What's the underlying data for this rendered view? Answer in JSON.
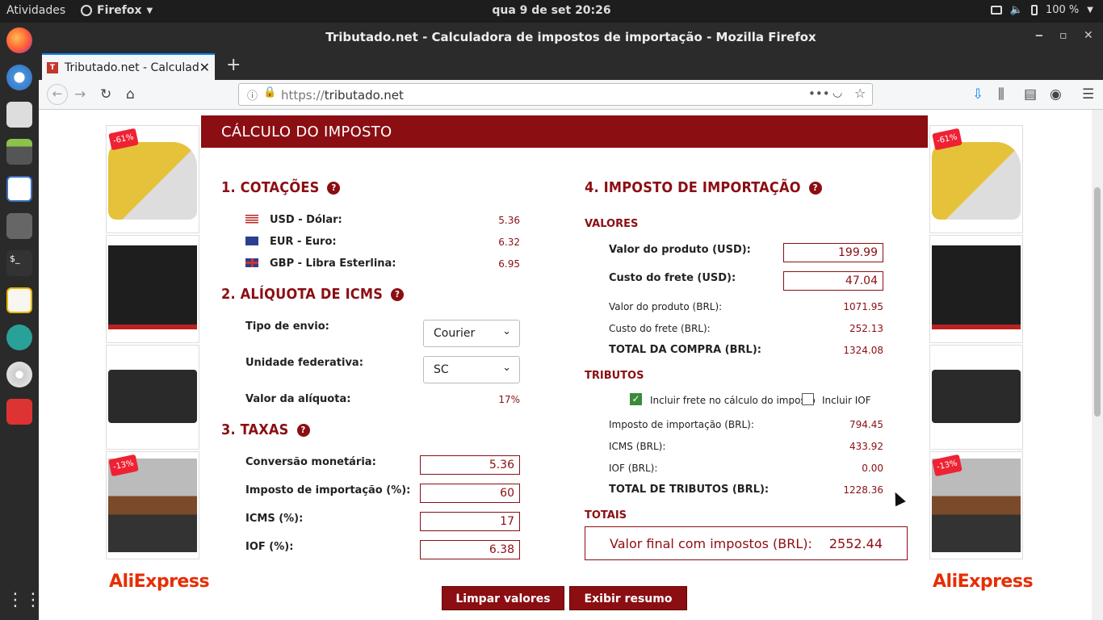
{
  "gnome": {
    "activities": "Atividades",
    "app_name": "Firefox",
    "clock": "qua 9 de set  20:26",
    "battery": "100 %"
  },
  "window": {
    "title": "Tributado.net - Calculadora de impostos de importação - Mozilla Firefox"
  },
  "tab": {
    "title": "Tributado.net - Calculad",
    "favicon": "T"
  },
  "url": {
    "scheme": "https://",
    "host": "tributado.net"
  },
  "ads": {
    "brand": "AliExpress",
    "badge_1": "-61%",
    "badge_2": "-13%"
  },
  "calc": {
    "header": "CÁLCULO DO IMPOSTO",
    "s1_title": "1. COTAÇÕES",
    "usd_label": "USD - Dólar:",
    "usd_value": "5.36",
    "eur_label": "EUR - Euro:",
    "eur_value": "6.32",
    "gbp_label": "GBP - Libra Esterlina:",
    "gbp_value": "6.95",
    "s2_title": "2. ALÍQUOTA DE ICMS",
    "tipo_label": "Tipo de envio:",
    "tipo_value": "Courier",
    "uf_label": "Unidade federativa:",
    "uf_value": "SC",
    "aliquota_label": "Valor da alíquota:",
    "aliquota_value": "17%",
    "s3_title": "3. TAXAS",
    "conv_label": "Conversão monetária:",
    "conv_value": "5.36",
    "ii_label": "Imposto de importação (%):",
    "ii_value": "60",
    "icms_label": "ICMS (%):",
    "icms_value": "17",
    "iof_label": "IOF (%):",
    "iof_value": "6.38",
    "s4_title": "4. IMPOSTO DE IMPORTAÇÃO",
    "valores": "VALORES",
    "prod_usd_label": "Valor do produto (USD):",
    "prod_usd_value": "199.99",
    "frete_usd_label": "Custo do frete (USD):",
    "frete_usd_value": "47.04",
    "prod_brl_label": "Valor do produto (BRL):",
    "prod_brl_value": "1071.95",
    "frete_brl_label": "Custo do frete (BRL):",
    "frete_brl_value": "252.13",
    "total_compra_label": "TOTAL DA COMPRA (BRL):",
    "total_compra_value": "1324.08",
    "tributos": "TRIBUTOS",
    "incl_frete_label": "Incluir frete no cálculo do imposto",
    "incl_iof_label": "Incluir IOF",
    "ii_brl_label": "Imposto de importação (BRL):",
    "ii_brl_value": "794.45",
    "icms_brl_label": "ICMS (BRL):",
    "icms_brl_value": "433.92",
    "iof_brl_label": "IOF (BRL):",
    "iof_brl_value": "0.00",
    "total_trib_label": "TOTAL DE TRIBUTOS (BRL):",
    "total_trib_value": "1228.36",
    "totais": "TOTAIS",
    "final_label": "Valor final com impostos (BRL):",
    "final_value": "2552.44",
    "btn_limpar": "Limpar valores",
    "btn_resumo": "Exibir resumo"
  }
}
